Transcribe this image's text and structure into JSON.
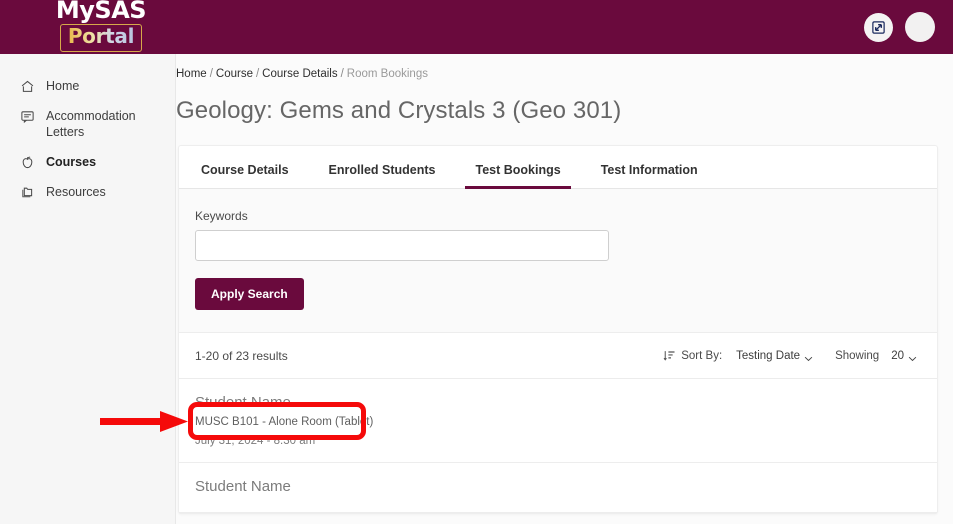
{
  "brand": {
    "logo_line1": "MySAS",
    "logo_line2": "Portal",
    "header_color": "#6a0a3d",
    "logo_border_color": "#d6a94a"
  },
  "header": {
    "expand_icon": "expand-arrows-icon",
    "avatar_icon": "user-avatar"
  },
  "sidebar": {
    "items": [
      {
        "label": "Home",
        "icon": "home-icon",
        "active": false
      },
      {
        "label": "Accommodation\nLetters",
        "icon": "letter-icon",
        "active": false
      },
      {
        "label": "Courses",
        "icon": "apple-icon",
        "active": true
      },
      {
        "label": "Resources",
        "icon": "folder-icon",
        "active": false
      }
    ]
  },
  "breadcrumb": {
    "item1": "Home",
    "item2": "Course",
    "item3": "Course Details",
    "current": "Room Bookings",
    "separator": "/"
  },
  "page": {
    "title": "Geology: Gems and Crystals 3 (Geo 301)"
  },
  "tabs": [
    {
      "label": "Course Details",
      "active": false
    },
    {
      "label": "Enrolled Students",
      "active": false
    },
    {
      "label": "Test Bookings",
      "active": true
    },
    {
      "label": "Test Information",
      "active": false
    }
  ],
  "search": {
    "keywords_label": "Keywords",
    "keywords_value": "",
    "keywords_placeholder": "",
    "apply_button": "Apply Search"
  },
  "results": {
    "count_text": "1-20 of 23 results",
    "sort_icon": "sort-icon",
    "sort_by_label": "Sort By:",
    "sort_value": "Testing Date",
    "showing_label": "Showing",
    "showing_value": "20"
  },
  "bookings": [
    {
      "student_name": "Student Name",
      "room": "MUSC B101 - Alone Room (Tablet)",
      "datetime": "July 31, 2024 - 8:30 am"
    },
    {
      "student_name": "Student Name",
      "room": "",
      "datetime": ""
    }
  ],
  "annotation": {
    "highlight_color": "#f50a0a",
    "target": "Student Name"
  }
}
